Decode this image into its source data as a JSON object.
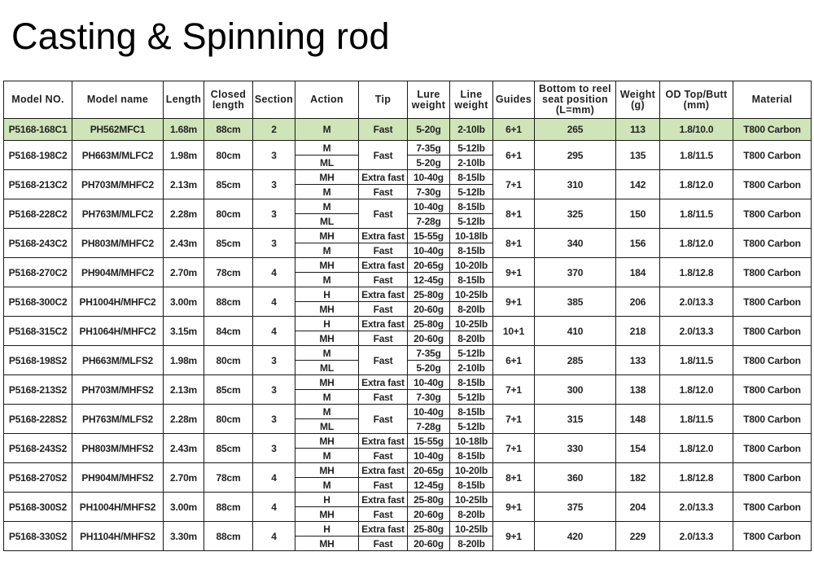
{
  "title": "Casting & Spinning rod",
  "colors": {
    "highlight_row": "#cfe4b9",
    "border": "#1a1a1a",
    "text": "#222222"
  },
  "headers": [
    "Model NO.",
    "Model name",
    "Length",
    "Closed\nlength",
    "Section",
    "Action",
    "Tip",
    "Lure\nweight",
    "Line\nweight",
    "Guides",
    "Bottom to reel\nseat position\n(L=mm)",
    "Weight\n(g)",
    "OD Top/Butt\n(mm)",
    "Material"
  ],
  "highlighted_row": {
    "model_no": "P5168-168C1",
    "model_name": "PH562MFC1",
    "length": "1.68m",
    "closed": "88cm",
    "section": "2",
    "action": "M",
    "tip": "Fast",
    "lure": "5-20g",
    "line": "2-10lb",
    "guides": "6+1",
    "reel_seat": "265",
    "weight": "113",
    "od": "1.8/10.0",
    "material": "T800 Carbon"
  },
  "rows": [
    {
      "model_no": "P5168-198C2",
      "model_name": "PH663M/MLFC2",
      "length": "1.98m",
      "closed": "80cm",
      "section": "3",
      "action": [
        "M",
        "ML"
      ],
      "tip": [
        "Fast"
      ],
      "lure": [
        "7-35g",
        "5-20g"
      ],
      "line": [
        "5-12lb",
        "2-10lb"
      ],
      "guides": "6+1",
      "reel_seat": "295",
      "weight": "135",
      "od": "1.8/11.5",
      "material": "T800 Carbon"
    },
    {
      "model_no": "P5168-213C2",
      "model_name": "PH703M/MHFC2",
      "length": "2.13m",
      "closed": "85cm",
      "section": "3",
      "action": [
        "MH",
        "M"
      ],
      "tip": [
        "Extra fast",
        "Fast"
      ],
      "lure": [
        "10-40g",
        "7-30g"
      ],
      "line": [
        "8-15lb",
        "5-12lb"
      ],
      "guides": "7+1",
      "reel_seat": "310",
      "weight": "142",
      "od": "1.8/12.0",
      "material": "T800 Carbon"
    },
    {
      "model_no": "P5168-228C2",
      "model_name": "PH763M/MLFC2",
      "length": "2.28m",
      "closed": "80cm",
      "section": "3",
      "action": [
        "M",
        "ML"
      ],
      "tip": [
        "Fast"
      ],
      "lure": [
        "10-40g",
        "7-28g"
      ],
      "line": [
        "8-15lb",
        "5-12lb"
      ],
      "guides": "8+1",
      "reel_seat": "325",
      "weight": "150",
      "od": "1.8/11.5",
      "material": "T800 Carbon"
    },
    {
      "model_no": "P5168-243C2",
      "model_name": "PH803M/MHFC2",
      "length": "2.43m",
      "closed": "85cm",
      "section": "3",
      "action": [
        "MH",
        "M"
      ],
      "tip": [
        "Extra fast",
        "Fast"
      ],
      "lure": [
        "15-55g",
        "10-40g"
      ],
      "line": [
        "10-18lb",
        "8-15lb"
      ],
      "guides": "8+1",
      "reel_seat": "340",
      "weight": "156",
      "od": "1.8/12.0",
      "material": "T800 Carbon"
    },
    {
      "model_no": "P5168-270C2",
      "model_name": "PH904M/MHFC2",
      "length": "2.70m",
      "closed": "78cm",
      "section": "4",
      "action": [
        "MH",
        "M"
      ],
      "tip": [
        "Extra fast",
        "Fast"
      ],
      "lure": [
        "20-65g",
        "12-45g"
      ],
      "line": [
        "10-20lb",
        "8-15lb"
      ],
      "guides": "9+1",
      "reel_seat": "370",
      "weight": "184",
      "od": "1.8/12.8",
      "material": "T800 Carbon"
    },
    {
      "model_no": "P5168-300C2",
      "model_name": "PH1004H/MHFC2",
      "length": "3.00m",
      "closed": "88cm",
      "section": "4",
      "action": [
        "H",
        "MH"
      ],
      "tip": [
        "Extra fast",
        "Fast"
      ],
      "lure": [
        "25-80g",
        "20-60g"
      ],
      "line": [
        "10-25lb",
        "8-20lb"
      ],
      "guides": "9+1",
      "reel_seat": "385",
      "weight": "206",
      "od": "2.0/13.3",
      "material": "T800 Carbon"
    },
    {
      "model_no": "P5168-315C2",
      "model_name": "PH1064H/MHFC2",
      "length": "3.15m",
      "closed": "84cm",
      "section": "4",
      "action": [
        "H",
        "MH"
      ],
      "tip": [
        "Extra fast",
        "Fast"
      ],
      "lure": [
        "25-80g",
        "20-60g"
      ],
      "line": [
        "10-25lb",
        "8-20lb"
      ],
      "guides": "10+1",
      "reel_seat": "410",
      "weight": "218",
      "od": "2.0/13.3",
      "material": "T800 Carbon"
    },
    {
      "model_no": "P5168-198S2",
      "model_name": "PH663M/MLFS2",
      "length": "1.98m",
      "closed": "80cm",
      "section": "3",
      "action": [
        "M",
        "ML"
      ],
      "tip": [
        "Fast"
      ],
      "lure": [
        "7-35g",
        "5-20g"
      ],
      "line": [
        "5-12lb",
        "2-10lb"
      ],
      "guides": "6+1",
      "reel_seat": "285",
      "weight": "133",
      "od": "1.8/11.5",
      "material": "T800 Carbon"
    },
    {
      "model_no": "P5168-213S2",
      "model_name": "PH703M/MHFS2",
      "length": "2.13m",
      "closed": "85cm",
      "section": "3",
      "action": [
        "MH",
        "M"
      ],
      "tip": [
        "Extra fast",
        "Fast"
      ],
      "lure": [
        "10-40g",
        "7-30g"
      ],
      "line": [
        "8-15lb",
        "5-12lb"
      ],
      "guides": "7+1",
      "reel_seat": "300",
      "weight": "138",
      "od": "1.8/12.0",
      "material": "T800 Carbon"
    },
    {
      "model_no": "P5168-228S2",
      "model_name": "PH763M/MLFS2",
      "length": "2.28m",
      "closed": "80cm",
      "section": "3",
      "action": [
        "M",
        "ML"
      ],
      "tip": [
        "Fast"
      ],
      "lure": [
        "10-40g",
        "7-28g"
      ],
      "line": [
        "8-15lb",
        "5-12lb"
      ],
      "guides": "7+1",
      "reel_seat": "315",
      "weight": "148",
      "od": "1.8/11.5",
      "material": "T800 Carbon"
    },
    {
      "model_no": "P5168-243S2",
      "model_name": "PH803M/MHFS2",
      "length": "2.43m",
      "closed": "85cm",
      "section": "3",
      "action": [
        "MH",
        "M"
      ],
      "tip": [
        "Extra fast",
        "Fast"
      ],
      "lure": [
        "15-55g",
        "10-40g"
      ],
      "line": [
        "10-18lb",
        "8-15lb"
      ],
      "guides": "7+1",
      "reel_seat": "330",
      "weight": "154",
      "od": "1.8/12.0",
      "material": "T800 Carbon"
    },
    {
      "model_no": "P5168-270S2",
      "model_name": "PH904M/MHFS2",
      "length": "2.70m",
      "closed": "78cm",
      "section": "4",
      "action": [
        "MH",
        "M"
      ],
      "tip": [
        "Extra fast",
        "Fast"
      ],
      "lure": [
        "20-65g",
        "12-45g"
      ],
      "line": [
        "10-20lb",
        "8-15lb"
      ],
      "guides": "8+1",
      "reel_seat": "360",
      "weight": "182",
      "od": "1.8/12.8",
      "material": "T800 Carbon"
    },
    {
      "model_no": "P5168-300S2",
      "model_name": "PH1004H/MHFS2",
      "length": "3.00m",
      "closed": "88cm",
      "section": "4",
      "action": [
        "H",
        "MH"
      ],
      "tip": [
        "Extra fast",
        "Fast"
      ],
      "lure": [
        "25-80g",
        "20-60g"
      ],
      "line": [
        "10-25lb",
        "8-20lb"
      ],
      "guides": "9+1",
      "reel_seat": "375",
      "weight": "204",
      "od": "2.0/13.3",
      "material": "T800 Carbon"
    },
    {
      "model_no": "P5168-330S2",
      "model_name": "PH1104H/MHFS2",
      "length": "3.30m",
      "closed": "88cm",
      "section": "4",
      "action": [
        "H",
        "MH"
      ],
      "tip": [
        "Extra fast",
        "Fast"
      ],
      "lure": [
        "25-80g",
        "20-60g"
      ],
      "line": [
        "10-25lb",
        "8-20lb"
      ],
      "guides": "9+1",
      "reel_seat": "420",
      "weight": "229",
      "od": "2.0/13.3",
      "material": "T800 Carbon"
    }
  ]
}
